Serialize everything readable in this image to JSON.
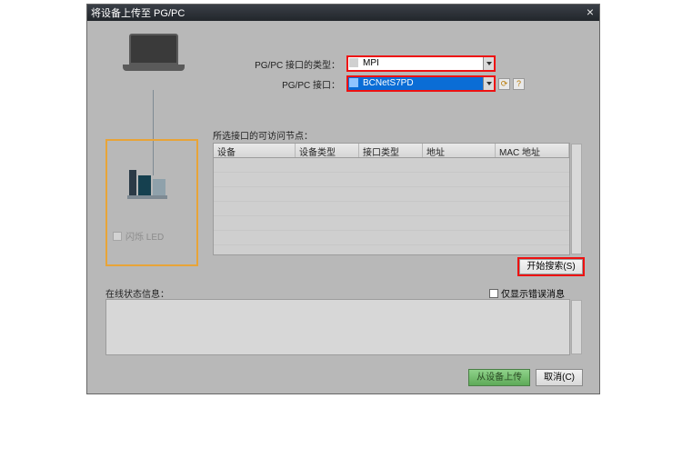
{
  "title": "将设备上传至 PG/PC",
  "form": {
    "label_type": "PG/PC 接口的类型：",
    "value_type": "MPI",
    "label_iface": "PG/PC 接口：",
    "value_iface": "BCNetS7PD"
  },
  "table": {
    "title": "所选接口的可访问节点：",
    "cols": {
      "c1": "设备",
      "c2": "设备类型",
      "c3": "接口类型",
      "c4": "地址",
      "c5": "MAC 地址"
    }
  },
  "flash_led": "闪烁 LED",
  "search_btn": "开始搜索(S)",
  "status_label": "在线状态信息：",
  "err_only": "仅显示错误消息",
  "buttons": {
    "upload": "从设备上传",
    "cancel": "取消(C)"
  }
}
